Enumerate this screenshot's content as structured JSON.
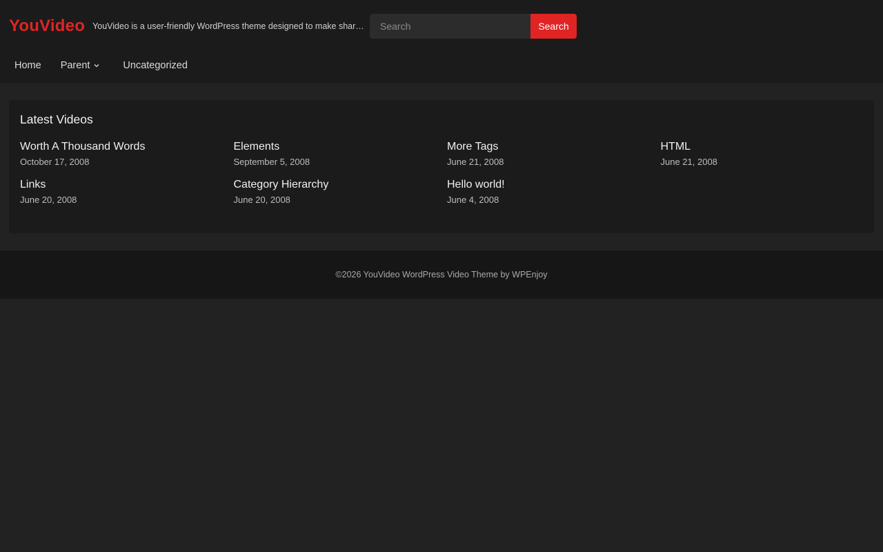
{
  "header": {
    "site_title": "YouVideo",
    "site_description": "YouVideo is a user-friendly WordPress theme designed to make sharing videos easy.",
    "search": {
      "placeholder": "Search",
      "button_label": "Search"
    }
  },
  "nav": {
    "items": [
      {
        "label": "Home"
      },
      {
        "label": "Parent",
        "has_dropdown": true
      },
      {
        "label": "Uncategorized"
      }
    ]
  },
  "latest": {
    "title": "Latest Videos",
    "items": [
      {
        "title": "Worth A Thousand Words",
        "date": "October 17, 2008"
      },
      {
        "title": "Elements",
        "date": "September 5, 2008"
      },
      {
        "title": "More Tags",
        "date": "June 21, 2008"
      },
      {
        "title": "HTML",
        "date": "June 21, 2008"
      },
      {
        "title": "Links",
        "date": "June 20, 2008"
      },
      {
        "title": "Category Hierarchy",
        "date": "June 20, 2008"
      },
      {
        "title": "Hello world!",
        "date": "June 4, 2008"
      }
    ]
  },
  "footer": {
    "copyright": "©2026 YouVideo",
    "theme_link": "WordPress Video Theme",
    "by": "by",
    "author_link": "WPEnjoy"
  },
  "colors": {
    "accent": "#e02424",
    "header_bg": "#1b1b1b",
    "page_bg": "#222222",
    "footer_bg": "#161616"
  }
}
